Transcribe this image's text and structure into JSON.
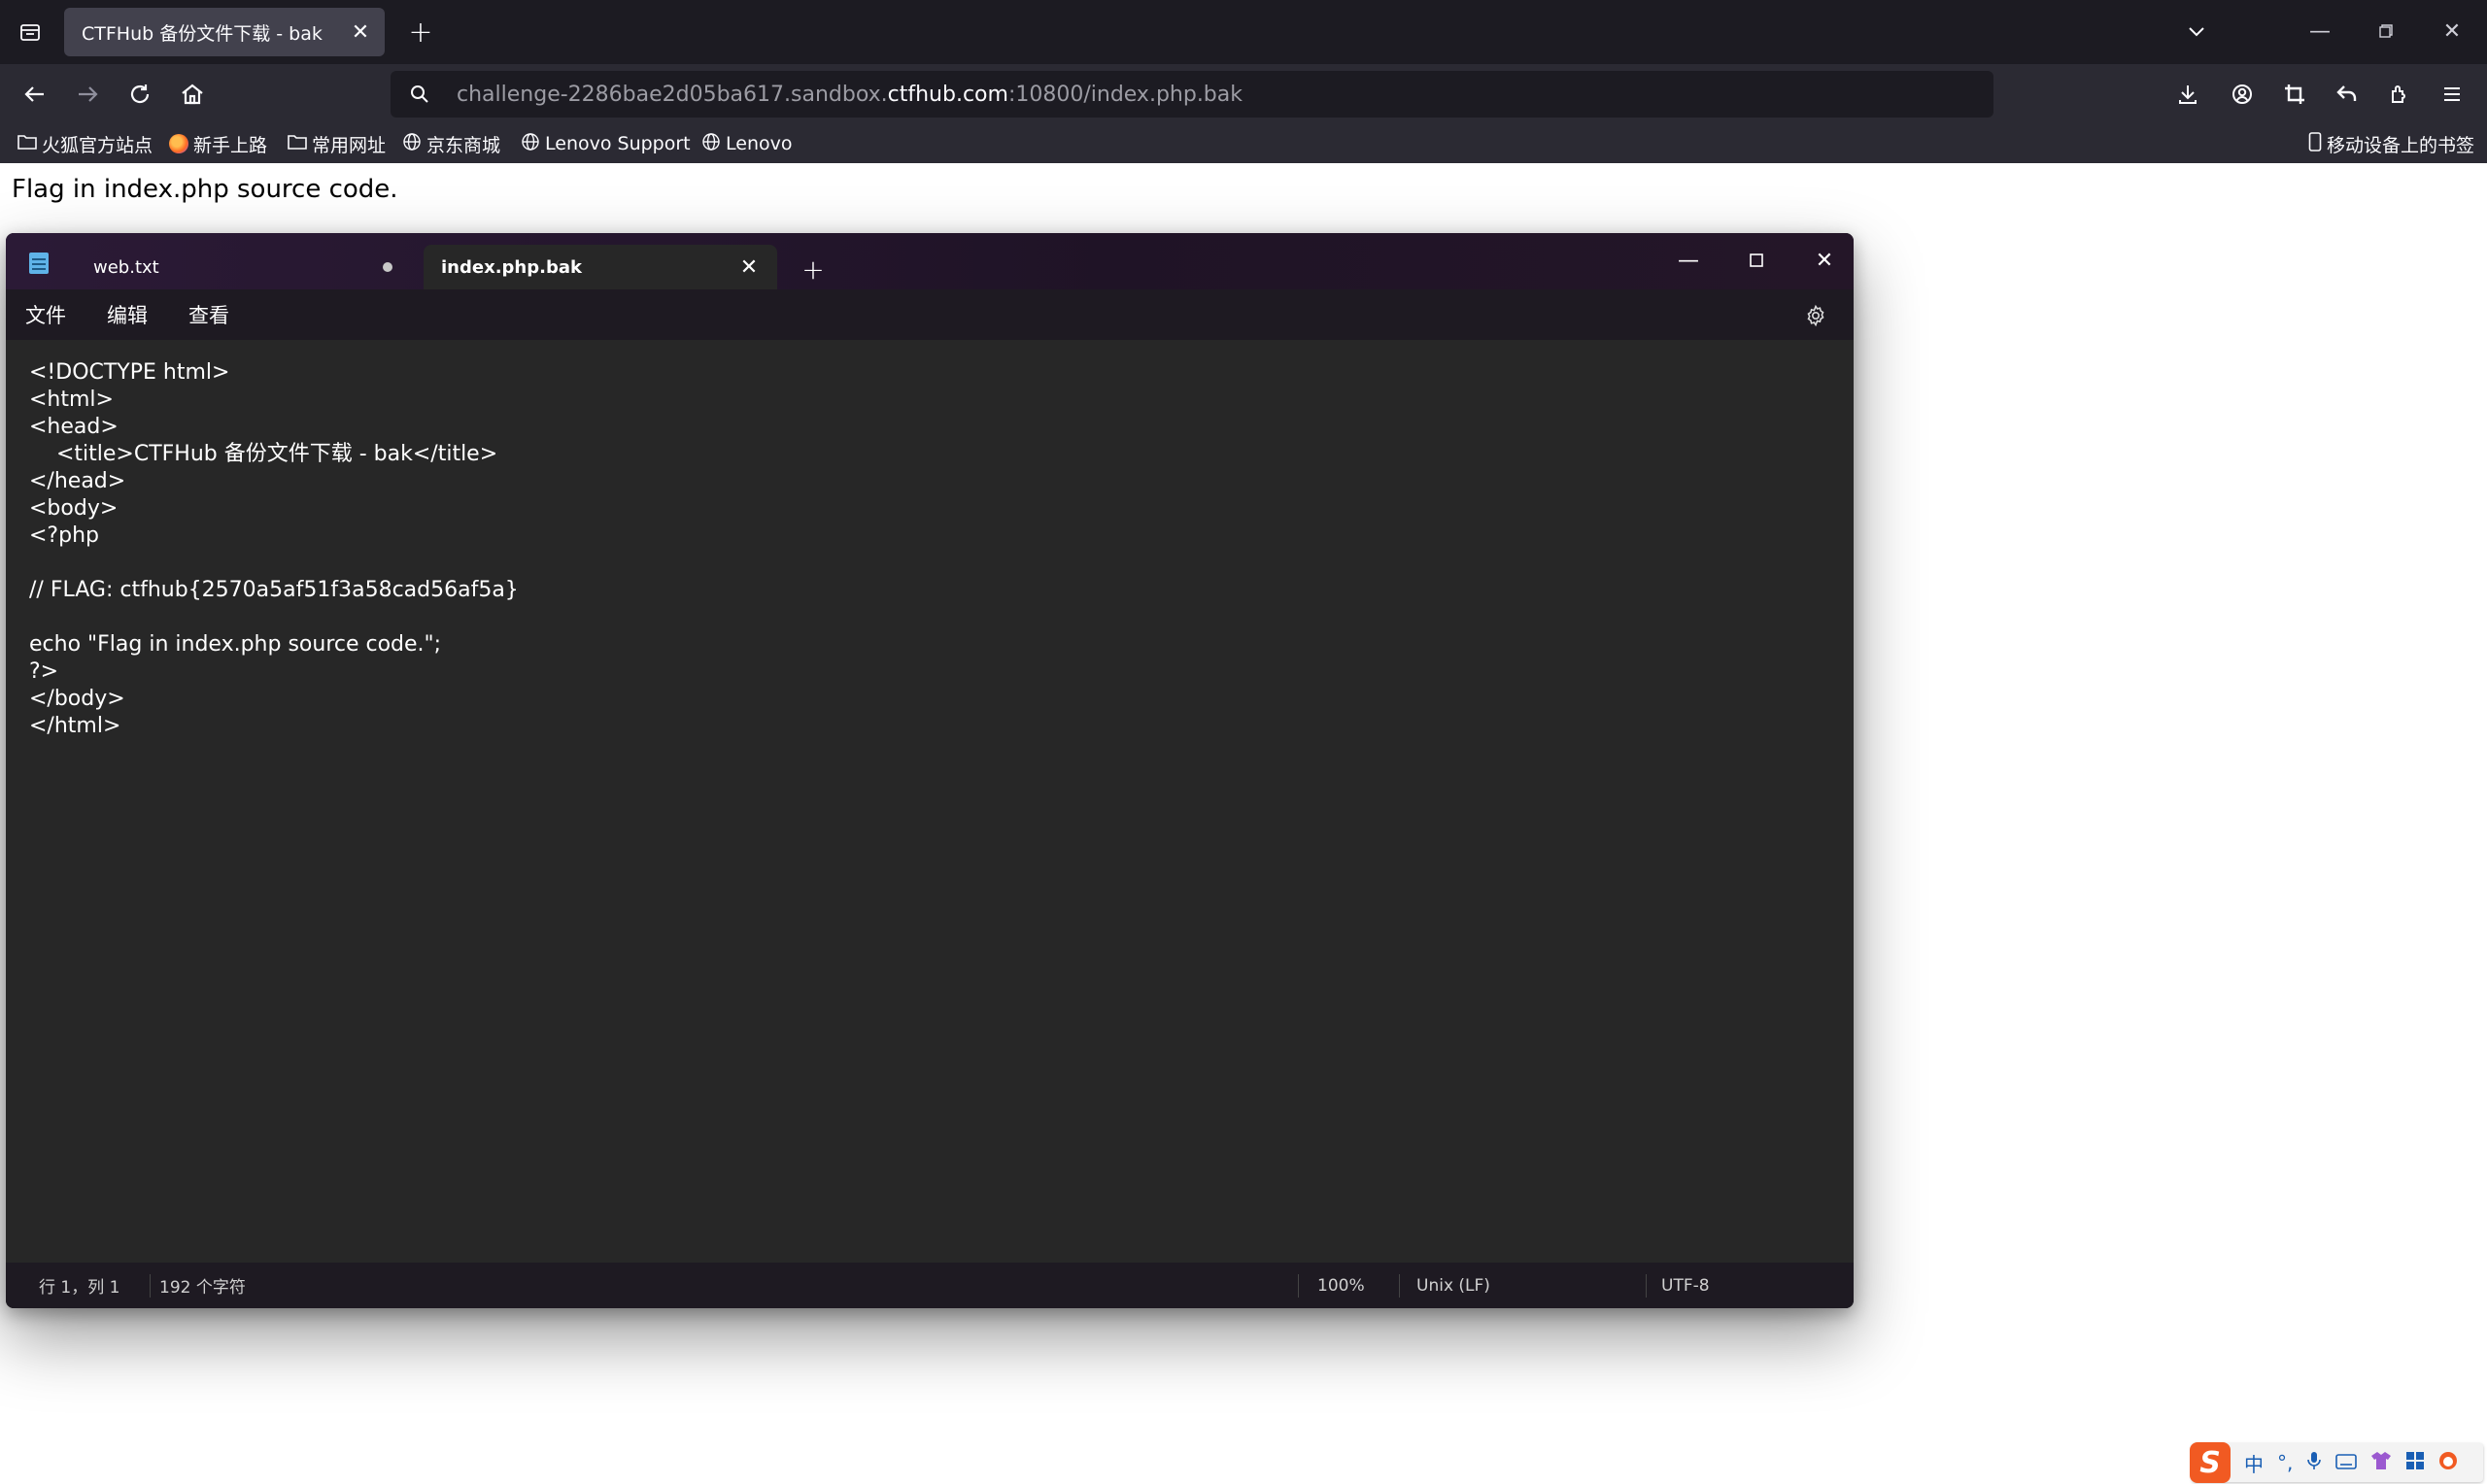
{
  "browser": {
    "tab_title": "CTFHub 备份文件下载 - bak",
    "url_prefix": "challenge-2286bae2d05ba617.sandbox.",
    "url_domain": "ctfhub.com",
    "url_suffix": ":10800/index.php.bak",
    "bookmarks": [
      {
        "label": "火狐官方站点",
        "icon": "folder-icon"
      },
      {
        "label": "新手上路",
        "icon": "firefox-icon"
      },
      {
        "label": "常用网址",
        "icon": "folder-icon"
      },
      {
        "label": "京东商城",
        "icon": "globe-icon"
      },
      {
        "label": "Lenovo Support",
        "icon": "globe-icon"
      },
      {
        "label": "Lenovo",
        "icon": "globe-icon"
      }
    ],
    "mobile_bookmarks": "移动设备上的书签"
  },
  "page": {
    "text": "Flag in index.php source code."
  },
  "notepad": {
    "tabs": [
      {
        "label": "web.txt",
        "modified": true
      },
      {
        "label": "index.php.bak",
        "active": true
      }
    ],
    "menu": [
      "文件",
      "编辑",
      "查看"
    ],
    "code_lines": [
      "<!DOCTYPE html>",
      "<html>",
      "<head>",
      "    <title>CTFHub 备份文件下载 - bak</title>",
      "</head>",
      "<body>",
      "<?php",
      "",
      "// FLAG: ctfhub{2570a5af51f3a58cad56af5a}",
      "",
      "echo \"Flag in index.php source code.\";",
      "?>",
      "</body>",
      "</html>"
    ],
    "status": {
      "position": "行 1，列 1",
      "char_count": "192 个字符",
      "zoom": "100%",
      "line_ending": "Unix (LF)",
      "encoding": "UTF-8"
    }
  },
  "ime": {
    "logo": "S",
    "mode": "中"
  }
}
